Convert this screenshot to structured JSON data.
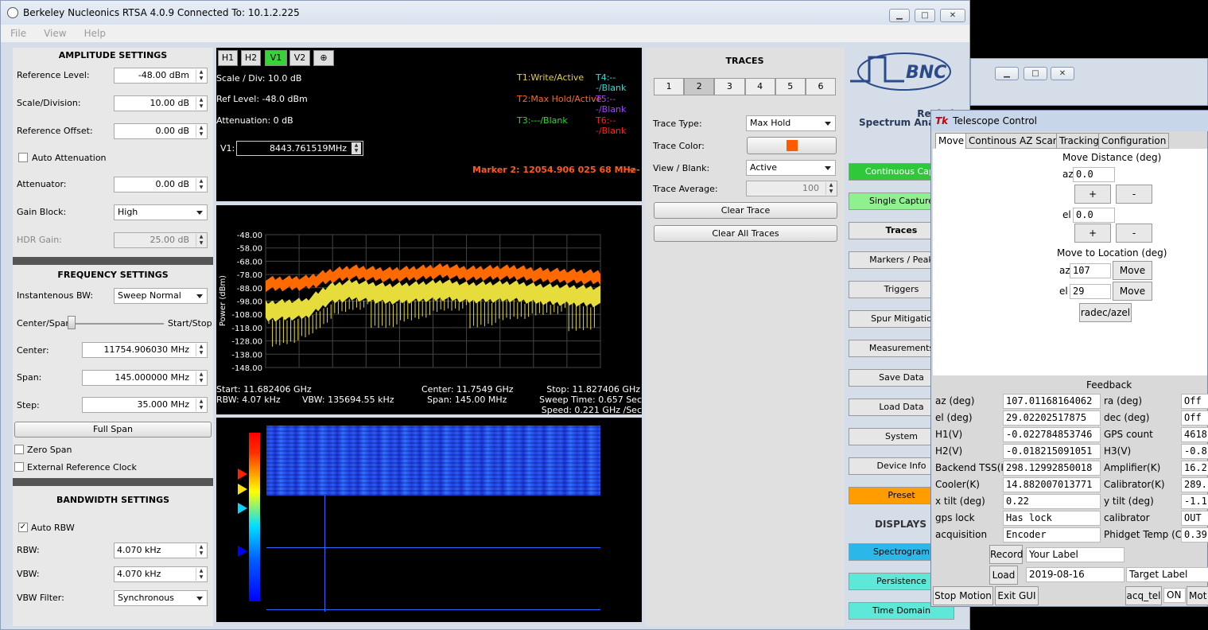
{
  "app": {
    "title": "Berkeley Nucleonics RTSA 4.0.9  Connected To: 10.1.2.225",
    "menu": [
      "File",
      "View",
      "Help"
    ]
  },
  "amplitude": {
    "heading": "AMPLITUDE SETTINGS",
    "ref_level_label": "Reference Level:",
    "ref_level": "-48.00 dBm",
    "scale_label": "Scale/Division:",
    "scale": "10.00 dB",
    "offset_label": "Reference Offset:",
    "offset": "0.00 dB",
    "auto_atten_label": "Auto Attenuation",
    "attenuator_label": "Attenuator:",
    "attenuator": "0.00 dB",
    "gain_block_label": "Gain Block:",
    "gain_block": "High",
    "hdr_gain_label": "HDR Gain:",
    "hdr_gain": "25.00 dB"
  },
  "frequency": {
    "heading": "FREQUENCY SETTINGS",
    "inst_bw_label": "Instantenous BW:",
    "inst_bw": "Sweep Normal",
    "center_span_label": "Center/Span",
    "start_stop_label": "Start/Stop",
    "center_label": "Center:",
    "center": "11754.906030 MHz",
    "span_label": "Span:",
    "span": "145.000000 MHz",
    "step_label": "Step:",
    "step": "35.000 MHz",
    "full_span": "Full Span",
    "zero_span": "Zero Span",
    "ext_ref": "External Reference Clock"
  },
  "bandwidth": {
    "heading": "BANDWIDTH SETTINGS",
    "auto_rbw": "Auto RBW",
    "rbw_label": "RBW:",
    "rbw": "4.070 kHz",
    "vbw_label": "VBW:",
    "vbw": "4.070 kHz",
    "vbw_filter_label": "VBW Filter:",
    "vbw_filter": "Synchronous"
  },
  "markers": {
    "buttons": [
      "H1",
      "H2",
      "V1",
      "V2"
    ],
    "scale": "Scale / Div: 10.0 dB",
    "ref": "Ref Level: -48.0 dBm",
    "atten": "Attenuation: 0 dB",
    "v1_label": "V1:",
    "v1_value": "8443.761519MHz",
    "marker2": "Marker 2: 12054.906 025 68 MHz",
    "marker2_tail": "---",
    "t1": "T1:Write/Active",
    "t2": "T2:Max Hold/Active",
    "t3": "T3:---/Blank",
    "t4": "T4:---/Blank",
    "t5": "T5:---/Blank",
    "t6": "T6:---/Blank",
    "colors": {
      "t1": "#e6d23c",
      "t2": "#ff6a1a",
      "t3": "#35d635",
      "t4": "#35d6d6",
      "t5": "#a040ff",
      "t6": "#ff2020"
    }
  },
  "chart_data": {
    "type": "line",
    "title": "",
    "ylabel": "Power (dBm)",
    "yticks": [
      "-48.00",
      "-58.00",
      "-68.00",
      "-78.00",
      "-88.00",
      "-98.00",
      "-108.00",
      "-118.00",
      "-128.00",
      "-138.00",
      "-148.00"
    ],
    "ylim": [
      -148,
      -48
    ],
    "series": [
      {
        "color": "#ff6a00",
        "x": [
          11682.406,
          11700,
          11710,
          11720,
          11735,
          11745,
          11760,
          11770,
          11790,
          11800,
          11827.406
        ],
        "values": [
          -81,
          -80,
          -75,
          -72,
          -74,
          -73,
          -71,
          -73,
          -72,
          -74,
          -76
        ]
      },
      {
        "color": "#e6dc3c",
        "x": [
          11682.406,
          11700,
          11710,
          11720,
          11735,
          11745,
          11760,
          11770,
          11790,
          11800,
          11827.406
        ],
        "values": [
          -99,
          -97,
          -86,
          -83,
          -86,
          -85,
          -83,
          -85,
          -84,
          -86,
          -88
        ]
      }
    ],
    "start": "Start: 11.682406 GHz",
    "center": "Center: 11.7549 GHz",
    "stop": "Stop: 11.827406 GHz",
    "rbw": "RBW: 4.07 kHz",
    "vbw": "VBW: 135694.55 kHz",
    "span": "Span: 145.00 MHz",
    "sweep": "Sweep Time: 0.657 Sec",
    "speed": "Speed: 0.221 GHz /Sec"
  },
  "traces": {
    "heading": "TRACES",
    "tabs": [
      "1",
      "2",
      "3",
      "4",
      "5",
      "6"
    ],
    "type_label": "Trace Type:",
    "type": "Max Hold",
    "color_label": "Trace Color:",
    "swatch": "#ff5a00",
    "view_label": "View / Blank:",
    "view": "Active",
    "avg_label": "Trace Average:",
    "avg": "100",
    "clear": "Clear Trace",
    "clear_all": "Clear All Traces"
  },
  "nav": {
    "brand": "BNC",
    "tag1": "Real Time",
    "tag2": "Spectrum Anal",
    "continuous": "Continuous Capt",
    "single": "Single Capture",
    "traces": "Traces",
    "markers": "Markers / Peak",
    "triggers": "Triggers",
    "spur": "Spur Mitigatio",
    "measurements": "Measurements",
    "save": "Save Data",
    "load": "Load Data",
    "system": "System",
    "device": "Device Info",
    "preset": "Preset",
    "displays": "DISPLAYS",
    "spectrogram": "Spectrogram",
    "persistence": "Persistence",
    "timedomain": "Time Domain"
  },
  "telescope": {
    "title": "Telescope Control",
    "tabs": [
      "Move",
      "Continous AZ Scans",
      "Tracking",
      "Configuration"
    ],
    "move_dist": "Move Distance (deg)",
    "az": "az",
    "el": "el",
    "az_step": "0.0",
    "el_step": "0.0",
    "plus": "+",
    "minus": "-",
    "move_loc": "Move to Location (deg)",
    "az_target": "107",
    "el_target": "29",
    "move": "Move",
    "radec": "radec/azel",
    "feedback": "Feedback",
    "fields": [
      [
        "az (deg)",
        "107.01168164062",
        "ra (deg)",
        "Off"
      ],
      [
        "el (deg)",
        "29.02202517875",
        "dec (deg)",
        "Off"
      ],
      [
        "H1(V)",
        "-0.022784853746",
        "GPS count",
        "4618"
      ],
      [
        "H2(V)",
        "-0.018215091051",
        "H3(V)",
        "-0.8"
      ],
      [
        "Backend TSS(K)",
        "298.12992850018",
        "Amplifier(K)",
        "16.2"
      ],
      [
        "Cooler(K)",
        "14.882007013771",
        "Calibrator(K)",
        "289."
      ],
      [
        "x tilt (deg)",
        "0.22",
        "y tilt (deg)",
        "-1.1"
      ],
      [
        "gps lock",
        "Has lock",
        "calibrator",
        "OUT"
      ],
      [
        "acquisition",
        "Encoder",
        "Phidget Temp (C)",
        "0.39"
      ]
    ],
    "record": "Record",
    "your_label": "Your Label",
    "load": "Load",
    "date": "2019-08-16",
    "target_label": "Target Label",
    "stop": "Stop Motion",
    "exit": "Exit GUI",
    "acq": "acq_tel",
    "on": "ON",
    "mot": "Mot"
  }
}
